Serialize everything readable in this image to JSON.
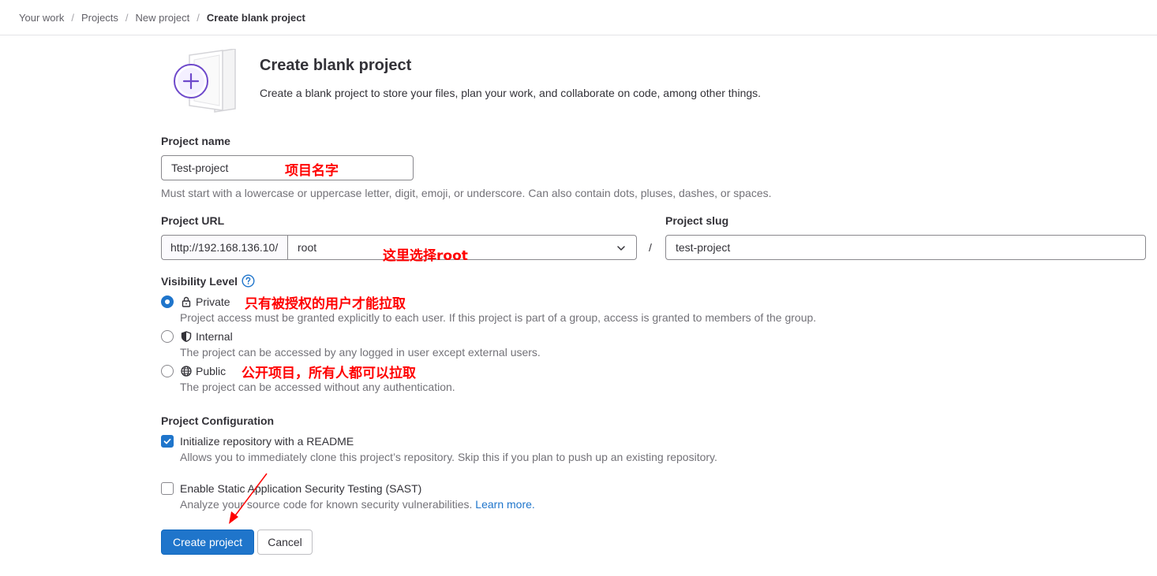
{
  "breadcrumb": {
    "items": [
      "Your work",
      "Projects",
      "New project"
    ],
    "current": "Create blank project",
    "separator": "/"
  },
  "header": {
    "icon": "plus-document-illustration",
    "title": "Create blank project",
    "description": "Create a blank project to store your files, plan your work, and collaborate on code, among other things."
  },
  "form": {
    "project_name": {
      "label": "Project name",
      "value": "Test-project",
      "help": "Must start with a lowercase or uppercase letter, digit, emoji, or underscore. Can also contain dots, pluses, dashes, or spaces."
    },
    "project_url": {
      "label": "Project URL",
      "prefix": "http://192.168.136.10/",
      "namespace": "root",
      "separator": "/"
    },
    "project_slug": {
      "label": "Project slug",
      "value": "test-project"
    },
    "visibility": {
      "label": "Visibility Level",
      "options": [
        {
          "label": "Private",
          "icon": "lock-icon",
          "checked": true,
          "description": "Project access must be granted explicitly to each user. If this project is part of a group, access is granted to members of the group."
        },
        {
          "label": "Internal",
          "icon": "shield-icon",
          "checked": false,
          "description": "The project can be accessed by any logged in user except external users."
        },
        {
          "label": "Public",
          "icon": "globe-icon",
          "checked": false,
          "description": "The project can be accessed without any authentication."
        }
      ]
    },
    "configuration": {
      "label": "Project Configuration",
      "readme": {
        "label": "Initialize repository with a README",
        "checked": true,
        "description": "Allows you to immediately clone this project’s repository. Skip this if you plan to push up an existing repository."
      },
      "sast": {
        "label": "Enable Static Application Security Testing (SAST)",
        "checked": false,
        "description": "Analyze your source code for known security vulnerabilities.",
        "link": "Learn more."
      }
    },
    "buttons": {
      "create": "Create project",
      "cancel": "Cancel"
    }
  },
  "annotations": {
    "project_name": "项目名字",
    "namespace": "这里选择root",
    "private": "只有被授权的用户才能拉取",
    "public": "公开项目，所有人都可以拉取"
  },
  "colors": {
    "primary": "#1f75cb",
    "annotation": "#ff0000",
    "illustration_accent": "#6e49cb"
  }
}
